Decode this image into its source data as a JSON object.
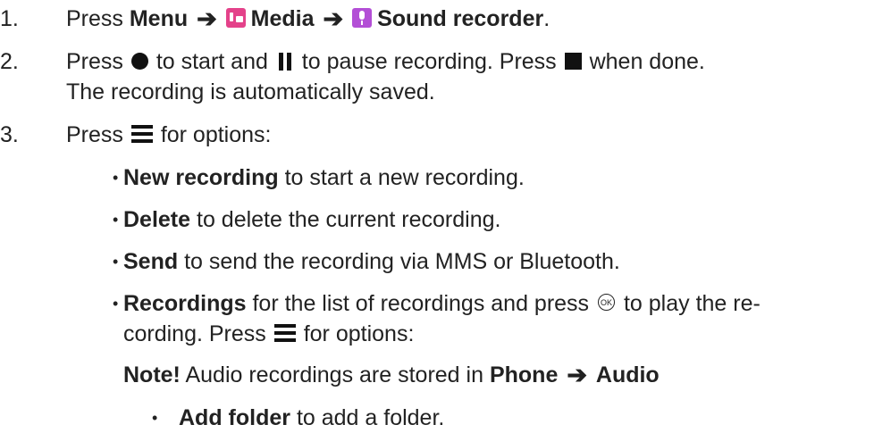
{
  "step1": {
    "number": "1.",
    "press": "Press",
    "menu": "Menu",
    "media": "Media",
    "sound_recorder": "Sound recorder",
    "period": ".",
    "media_icon": "media-app-icon",
    "sound_icon": "microphone-app-icon"
  },
  "step2": {
    "number": "2.",
    "press_a": "Press",
    "text_a": "to start and",
    "text_b": "to pause recording. Press",
    "text_c": "when done.",
    "line2": "The recording is automatically saved."
  },
  "step3": {
    "number": "3.",
    "press": "Press",
    "text": "for options:"
  },
  "options": [
    {
      "bold": "New recording",
      "text": " to start a new recording."
    },
    {
      "bold": "Delete",
      "text": " to delete the current recording."
    },
    {
      "bold": "Send",
      "text": " to send the recording via MMS or Bluetooth."
    }
  ],
  "recordings": {
    "bold": "Recordings",
    "text_a": "for the list of recordings and press",
    "ok_label": "OK",
    "text_b": "to play the re-",
    "line2_a": "cording. Press",
    "line2_b": "for options:"
  },
  "note": {
    "bold": "Note!",
    "text": "Audio recordings are stored in",
    "phone": "Phone",
    "audio": "Audio"
  },
  "sub_option": {
    "bold": "Add folder",
    "text": " to add a folder."
  },
  "bullet_char": "•",
  "arrow_char": "➔",
  "colors": {
    "text": "#222222",
    "media_icon": "#e4428a",
    "sound_icon": "#b34fd6"
  }
}
